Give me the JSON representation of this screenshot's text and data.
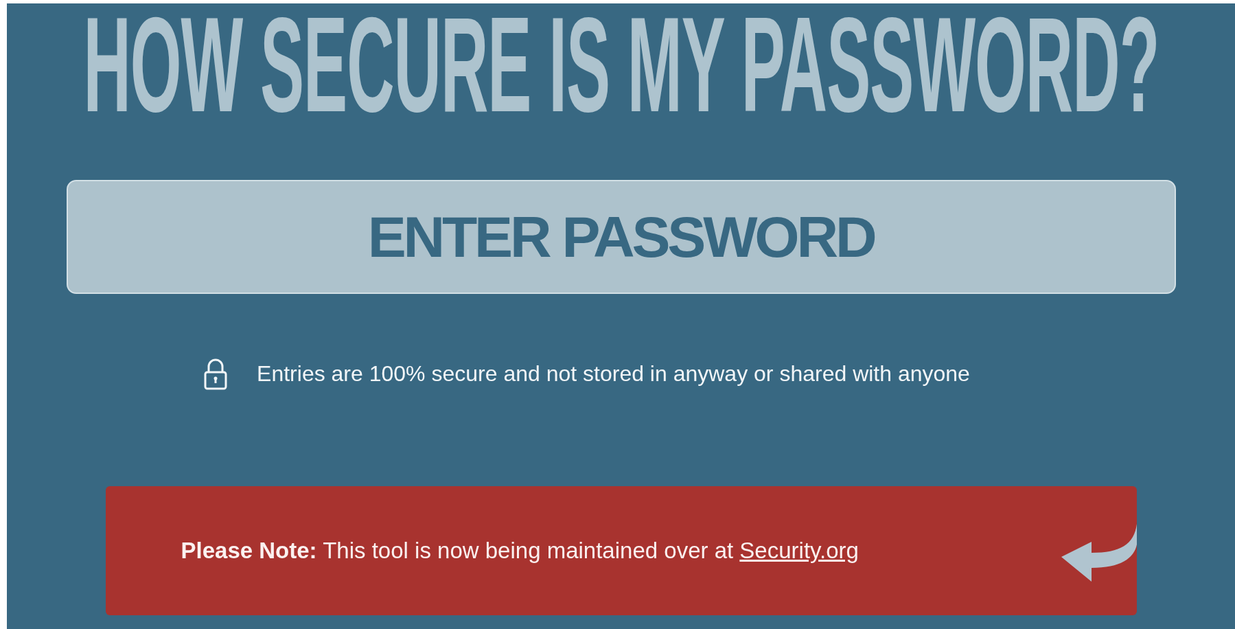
{
  "title": "HOW SECURE IS MY PASSWORD?",
  "password_field": {
    "placeholder": "ENTER PASSWORD"
  },
  "security_note": "Entries are 100% secure and not stored in anyway or shared with anyone",
  "notice": {
    "text": "**Please Note:** This tool is now being maintained over at ",
    "link": "Security.org"
  }
}
